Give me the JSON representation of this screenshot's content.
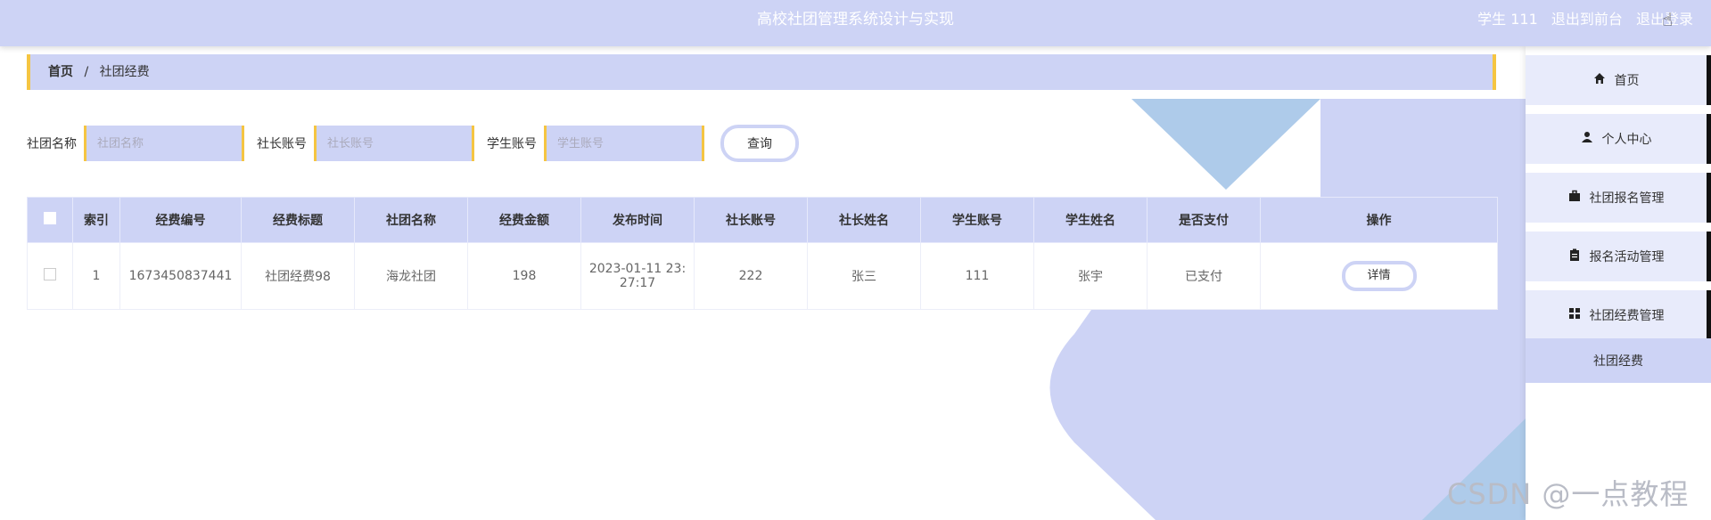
{
  "header": {
    "title": "高校社团管理系统设计与实现",
    "user": "学生 111",
    "exit_front": "退出到前台",
    "logout": "退出登录"
  },
  "breadcrumb": {
    "home": "首页",
    "separator": "/",
    "current": "社团经费"
  },
  "search": {
    "club_name_label": "社团名称",
    "club_name_placeholder": "社团名称",
    "leader_label": "社长账号",
    "leader_placeholder": "社长账号",
    "student_label": "学生账号",
    "student_placeholder": "学生账号",
    "query_button": "查询"
  },
  "table": {
    "headers": [
      "索引",
      "经费编号",
      "经费标题",
      "社团名称",
      "经费金额",
      "发布时间",
      "社长账号",
      "社长姓名",
      "学生账号",
      "学生姓名",
      "是否支付",
      "操作"
    ],
    "rows": [
      {
        "index": "1",
        "fee_no": "1673450837441",
        "fee_title": "社团经费98",
        "club_name": "海龙社团",
        "amount": "198",
        "publish_time_line1": "2023-01-11 23:",
        "publish_time_line2": "27:17",
        "leader_account": "222",
        "leader_name": "张三",
        "student_account": "111",
        "student_name": "张宇",
        "paid": "已支付",
        "action": "详情"
      }
    ]
  },
  "sidebar": {
    "items": [
      {
        "label": "首页",
        "icon": "home-icon"
      },
      {
        "label": "个人中心",
        "icon": "user-icon"
      },
      {
        "label": "社团报名管理",
        "icon": "briefcase-icon"
      },
      {
        "label": "报名活动管理",
        "icon": "clipboard-icon"
      },
      {
        "label": "社团经费管理",
        "icon": "grid-icon"
      }
    ],
    "sub_item": "社团经费"
  },
  "watermark": "CSDN @一点教程",
  "colors": {
    "primary": "#cdd3f5",
    "accent": "#f5c542",
    "shape": "#a9c7ea"
  }
}
